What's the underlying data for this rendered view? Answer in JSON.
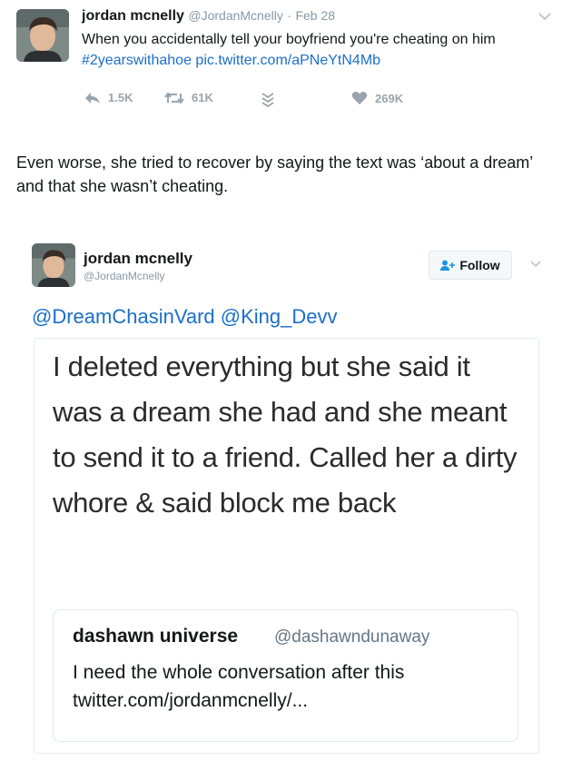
{
  "tweet1": {
    "name": "jordan mcnelly",
    "handle": "@JordanMcnelly",
    "separator": "·",
    "date": "Feb 28",
    "text": "When you accidentally tell your boyfriend you're cheating on him ",
    "hashtag": "#2yearswithahoe",
    "link": "pic.twitter.com/aPNeYtN4Mb",
    "actions": {
      "replies": "1.5K",
      "retweets": "61K",
      "likes": "269K"
    },
    "icons": [
      "reply-icon",
      "retweet-icon",
      "direct-message-icon",
      "heart-icon",
      "chevron-down-icon"
    ]
  },
  "caption": "Even worse, she tried to recover by saying the text was ‘about a dream’ and that she wasn’t cheating.",
  "tweet2": {
    "name": "jordan mcnelly",
    "handle": "@JordanMcnelly",
    "follow_label": "Follow",
    "mentions": "@DreamChasinVard @King_Devv",
    "screenshot": {
      "text": "I deleted everything but she said it was a dream she had and she meant to send it to a friend. Called her a dirty whore & said block me back",
      "quoted": {
        "name": "dashawn universe",
        "handle": "@dashawndunaway",
        "text": "I need the whole conversation after this twitter.com/jordanmcnelly/..."
      }
    }
  },
  "colors": {
    "link": "#1b6fc8",
    "muted": "#8899a6",
    "icon": "#9aa4ad",
    "text": "#14171a"
  }
}
